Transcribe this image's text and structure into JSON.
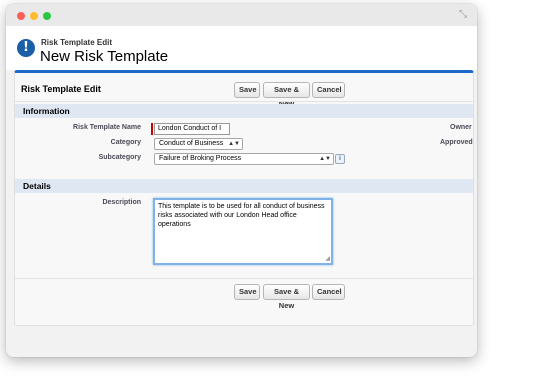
{
  "window": {
    "fullscreen_icon": "expand-arrows-icon"
  },
  "header": {
    "subtitle": "Risk Template Edit",
    "title": "New Risk Template",
    "icon": "exclamation-icon",
    "icon_glyph": "!"
  },
  "panel": {
    "title": "Risk Template Edit",
    "top_buttons": {
      "save": "Save",
      "save_new": "Save & New",
      "cancel": "Cancel"
    },
    "bottom_buttons": {
      "save": "Save",
      "save_new": "Save & New",
      "cancel": "Cancel"
    }
  },
  "information": {
    "section_title": "Information",
    "name_label": "Risk Template Name",
    "name_value": "London Conduct of I",
    "category_label": "Category",
    "category_value": "Conduct of Business",
    "subcategory_label": "Subcategory",
    "subcategory_value": "Failure of Broking Process",
    "owner_label": "Owner",
    "approved_label": "Approved",
    "info_glyph": "i"
  },
  "details": {
    "section_title": "Details",
    "description_label": "Description",
    "description_value": "This template is to be used for all conduct of business risks associated with our London Head office operations"
  },
  "colors": {
    "accent": "#1b6ac9",
    "required": "#cc0000",
    "section_bar": "#dfe8f2"
  }
}
